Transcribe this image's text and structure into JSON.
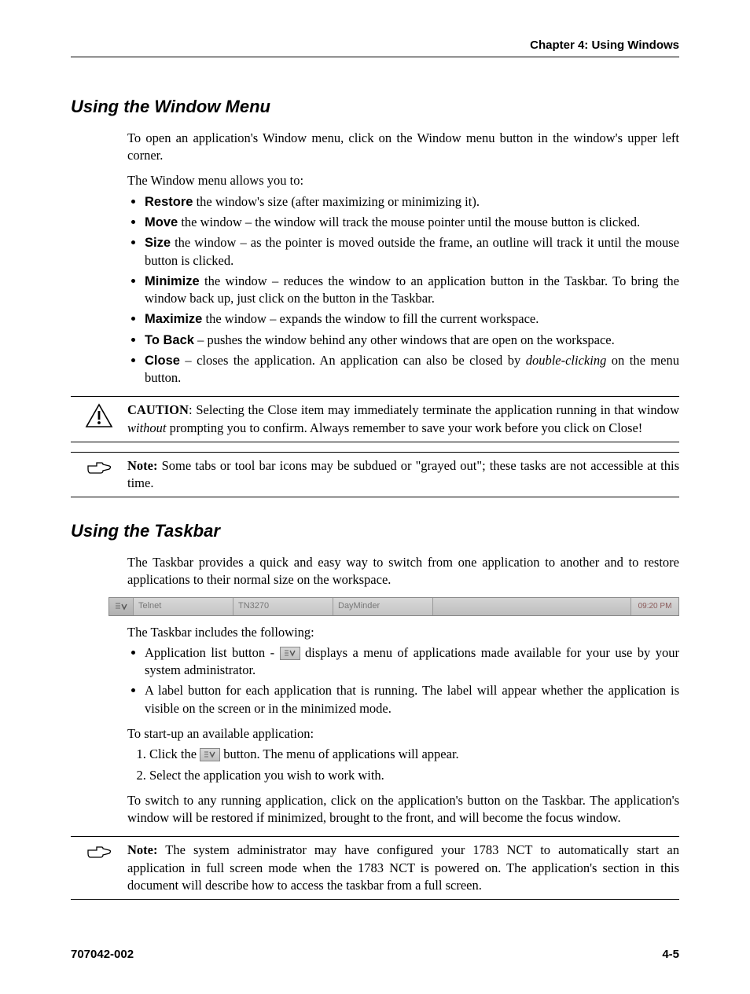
{
  "header": {
    "chapter": "Chapter 4: Using Windows"
  },
  "section1": {
    "title": "Using the Window Menu",
    "intro": "To open an application's Window menu, click on the Window menu button in the window's upper left corner.",
    "allows": "The Window menu allows you to:",
    "items": {
      "restore": {
        "label": "Restore",
        "text": " the window's size (after maximizing or minimizing it)."
      },
      "move": {
        "label": "Move",
        "text": " the window – the window will track the mouse pointer until the mouse button is clicked."
      },
      "size": {
        "label": "Size",
        "text": " the window – as the pointer is moved outside the frame, an outline will track it until the mouse button is clicked."
      },
      "minimize": {
        "label": "Minimize",
        "text": " the window – reduces the window to an application button in the Taskbar. To bring the window back up, just click on the button in the Taskbar."
      },
      "maximize": {
        "label": "Maximize",
        "text": " the window – expands the window to fill the current workspace."
      },
      "toback": {
        "label": "To Back",
        "text": " – pushes the window behind any other windows that are open on the workspace."
      },
      "close": {
        "label": "Close",
        "pre": " – closes the application. An application can also be closed by ",
        "em": "double-clicking",
        "post": " on the menu button."
      }
    },
    "caution": {
      "label": "CAUTION",
      "pre": ": Selecting the Close item may immediately terminate the application running in that window ",
      "em": "without",
      "post": " prompting you to confirm. Always remember to save your work before you click on Close!"
    },
    "note": {
      "label": "Note:",
      "text": " Some tabs or tool bar icons may be subdued or \"grayed out\"; these tasks are not accessible at this time."
    }
  },
  "section2": {
    "title": "Using the Taskbar",
    "intro": "The Taskbar provides a quick and easy way to switch from one application to another and to restore applications to their normal size on the workspace.",
    "taskbar": {
      "btn1": "Telnet",
      "btn2": "TN3270",
      "btn3": "DayMinder",
      "clock": "09:20 PM"
    },
    "includes": "The Taskbar includes the following:",
    "bullets": {
      "b1a": "Application list button - ",
      "b1b": " displays a menu of applications made available for your use by your system administrator.",
      "b2": "A label button for each application that is running. The label will appear whether the application is visible on the screen or in the minimized mode."
    },
    "startup": "To start-up an available application:",
    "steps": {
      "s1a": "Click the ",
      "s1b": " button. The menu of applications will appear.",
      "s2": "Select the application you wish to work with."
    },
    "switch": "To switch to any running application, click on the application's button on the Taskbar. The application's window will be restored if minimized, brought to the front, and will become the focus window.",
    "note": {
      "label": "Note:",
      "text": " The system administrator may have configured your 1783 NCT to automatically start an application in full screen mode when the 1783 NCT is powered on. The application's section in this document will describe how to access the taskbar from a full screen."
    }
  },
  "footer": {
    "left": "707042-002",
    "right": "4-5"
  }
}
